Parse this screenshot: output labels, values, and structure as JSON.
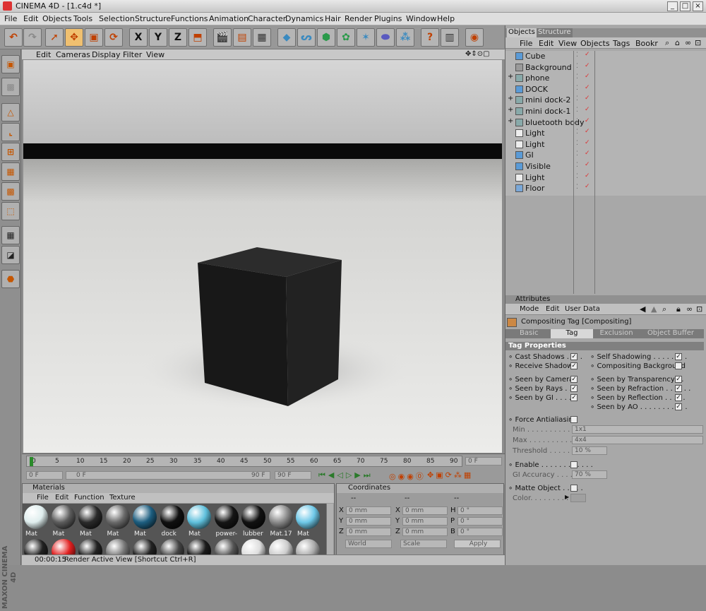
{
  "window": {
    "title": "CINEMA 4D - [1.c4d *]",
    "buttons": [
      "_",
      "□",
      "×"
    ]
  },
  "menubar": [
    "File",
    "Edit",
    "Objects",
    "Tools",
    "Selection",
    "Structure",
    "Functions",
    "Animation",
    "Character",
    "Dynamics",
    "Hair",
    "Render",
    "Plugins",
    "Window",
    "Help"
  ],
  "toolbar": {
    "axis": [
      "X",
      "Y",
      "Z"
    ]
  },
  "viewport": {
    "menu": [
      "Edit",
      "Cameras",
      "Display",
      "Filter",
      "View"
    ]
  },
  "timeline": {
    "ticks": [
      "0",
      "5",
      "10",
      "15",
      "20",
      "25",
      "30",
      "35",
      "40",
      "45",
      "50",
      "55",
      "60",
      "65",
      "70",
      "75",
      "80",
      "85",
      "90"
    ],
    "current": "0 F",
    "start": "0 F",
    "end": "90 F",
    "range_left": "0 F",
    "range_right": "90 F"
  },
  "materials": {
    "title": "Materials",
    "menu": [
      "File",
      "Edit",
      "Function",
      "Texture"
    ],
    "items": [
      {
        "label": "Mat",
        "color": "#dfeeee"
      },
      {
        "label": "Mat",
        "color": "#5c5c5c"
      },
      {
        "label": "Mat",
        "color": "#2a2a2a"
      },
      {
        "label": "Mat",
        "color": "#6a6a6a"
      },
      {
        "label": "Mat",
        "color": "#1d5e80"
      },
      {
        "label": "dock",
        "color": "#101010"
      },
      {
        "label": "Mat",
        "color": "#5fc0dc"
      },
      {
        "label": "power-",
        "color": "#151515"
      },
      {
        "label": "lubber",
        "color": "#111111"
      },
      {
        "label": "Mat.17",
        "color": "#8a8a8a"
      },
      {
        "label": "Mat",
        "color": "#6ec8e8"
      }
    ],
    "row2_colors": [
      "#222",
      "#e02020",
      "#222",
      "#777",
      "#222",
      "#444",
      "#1a1a1a",
      "#555",
      "#ddd",
      "#ccc",
      "#aaa"
    ]
  },
  "coords": {
    "title": "Coordinates",
    "headers": [
      "--",
      "--",
      "--"
    ],
    "rows": [
      {
        "a": "X",
        "av": "0 mm",
        "b": "X",
        "bv": "0 mm",
        "c": "H",
        "cv": "0 °"
      },
      {
        "a": "Y",
        "av": "0 mm",
        "b": "Y",
        "bv": "0 mm",
        "c": "P",
        "cv": "0 °"
      },
      {
        "a": "Z",
        "av": "0 mm",
        "b": "Z",
        "bv": "0 mm",
        "c": "B",
        "cv": "0 °"
      }
    ],
    "mode": "World",
    "type": "Scale",
    "apply": "Apply"
  },
  "objects": {
    "tabs": [
      "Objects",
      "Structure"
    ],
    "menu": [
      "File",
      "Edit",
      "View",
      "Objects",
      "Tags",
      "Bookr"
    ],
    "items": [
      {
        "name": "Cube",
        "icon": "cube-icon",
        "color": "#5a9ad6",
        "expand": ""
      },
      {
        "name": "Background",
        "icon": "background-icon",
        "color": "#9a9a9a",
        "expand": ""
      },
      {
        "name": "phone",
        "icon": "null-icon",
        "color": "#8aa",
        "expand": "+"
      },
      {
        "name": "DOCK",
        "icon": "dock-icon",
        "color": "#5a9ad6",
        "expand": ""
      },
      {
        "name": "mini dock-2",
        "icon": "null-icon",
        "color": "#8aa",
        "expand": "+"
      },
      {
        "name": "mini dock-1",
        "icon": "null-icon",
        "color": "#8aa",
        "expand": "+"
      },
      {
        "name": "bluetooth body",
        "icon": "null-icon",
        "color": "#8aa",
        "expand": "+"
      },
      {
        "name": "Light",
        "icon": "light-icon",
        "color": "#eee",
        "expand": ""
      },
      {
        "name": "Light",
        "icon": "light-icon",
        "color": "#eee",
        "expand": ""
      },
      {
        "name": "GI",
        "icon": "gi-icon",
        "color": "#5a9ad6",
        "expand": ""
      },
      {
        "name": "Visible",
        "icon": "visible-icon",
        "color": "#5a9ad6",
        "expand": ""
      },
      {
        "name": "Light",
        "icon": "light-icon",
        "color": "#eee",
        "expand": ""
      },
      {
        "name": "Floor",
        "icon": "floor-icon",
        "color": "#7aa8d8",
        "expand": ""
      }
    ]
  },
  "attributes": {
    "title": "Attributes",
    "menu": [
      "Mode",
      "Edit",
      "User Data"
    ],
    "object": "Compositing Tag [Compositing]",
    "tabs": [
      "Basic",
      "Tag",
      "Exclusion",
      "Object Buffer"
    ],
    "section": "Tag Properties",
    "left_opts": [
      {
        "label": "Cast Shadows . . . .",
        "checked": "✓"
      },
      {
        "label": "Receive Shadows",
        "checked": "✓"
      },
      {
        "label": "Seen by Camera",
        "checked": "✓"
      },
      {
        "label": "Seen by Rays . .",
        "checked": "✓"
      },
      {
        "label": "Seen by GI . . . . .",
        "checked": "✓"
      }
    ],
    "right_opts": [
      {
        "label": "Self Shadowing . . . . . . . .",
        "checked": "✓"
      },
      {
        "label": "Compositing Background",
        "checked": ""
      },
      {
        "label": "Seen by Transparency . .",
        "checked": "✓"
      },
      {
        "label": "Seen by Refraction . . . . . .",
        "checked": "✓"
      },
      {
        "label": "Seen by Reflection . . . . .",
        "checked": "✓"
      },
      {
        "label": "Seen by AO . . . . . . . . . . .",
        "checked": "✓"
      }
    ],
    "force_aa": "Force Antialiasing",
    "min_label": "Min . . . . . . . . . . . . . .",
    "min_val": "1x1",
    "max_label": "Max . . . . . . . . . . . . . .",
    "max_val": "4x4",
    "thr_label": "Threshold . . . . . . . .",
    "thr_val": "10 %",
    "enable": "Enable . . . . . . . . . . . .",
    "gi_label": "GI Accuracy . . . . . . .",
    "gi_val": "70 %",
    "matte": "Matte Object . . . . .",
    "color_label": "Color. . . . . . . . . . . ."
  },
  "status": {
    "time": "00:00:15",
    "text": "Render Active View [Shortcut Ctrl+R]"
  }
}
